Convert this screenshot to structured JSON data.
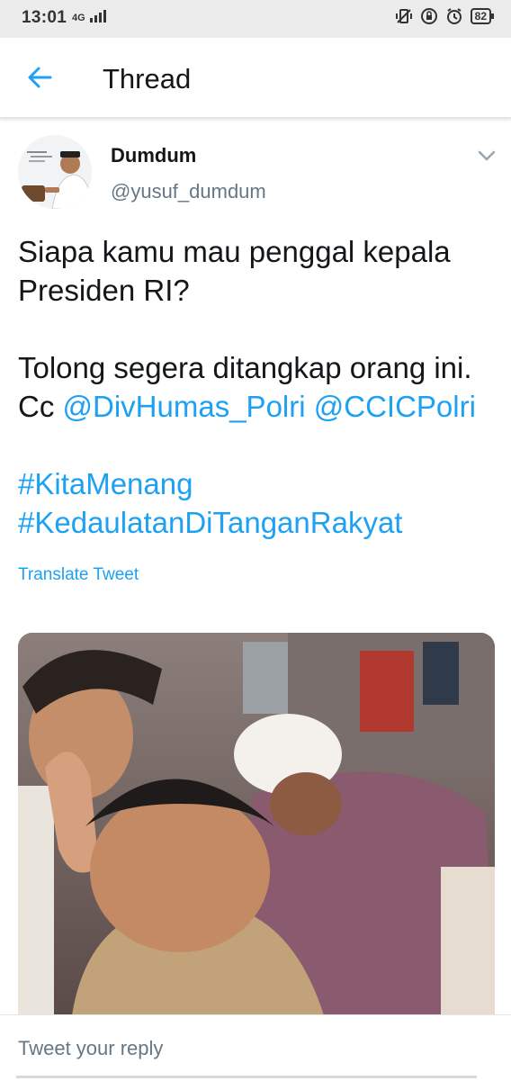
{
  "status_bar": {
    "time": "13:01",
    "network": "4G",
    "battery": "82"
  },
  "header": {
    "title": "Thread"
  },
  "tweet": {
    "author_name": "Dumdum",
    "author_handle": "@yusuf_dumdum",
    "line1": "Siapa kamu mau penggal kepala",
    "line2": "Presiden RI?",
    "line3": "Tolong segera ditangkap orang ini.",
    "line4_prefix": "Cc",
    "mention1": "@DivHumas_Polri",
    "mention2": "@CCICPolri",
    "hashtag1": "#KitaMenang",
    "hashtag2": "#KedaulatanDiTanganRakyat",
    "translate_label": "Translate Tweet"
  },
  "reply": {
    "placeholder": "Tweet your reply"
  },
  "colors": {
    "accent": "#1da1f2",
    "secondary_text": "#657786",
    "status_bar_bg": "#ececec"
  },
  "icons": {
    "back": "arrow-left-icon",
    "more": "chevron-down-icon"
  }
}
